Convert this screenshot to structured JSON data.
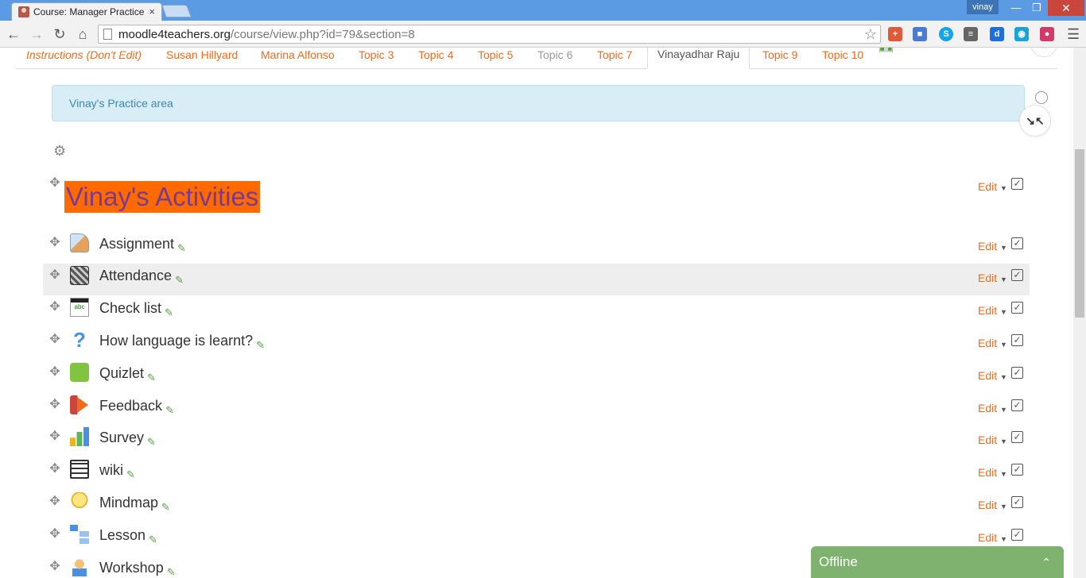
{
  "browser": {
    "tab_title": "Course: Manager Practice",
    "tab_close": "×",
    "user_name": "vinay",
    "url_host": "moodle4teachers.org",
    "url_path": "/course/view.php?id=79&section=8"
  },
  "course_tabs": [
    {
      "label": "Instructions (Don't Edit)",
      "style": "italic"
    },
    {
      "label": "Susan Hillyard"
    },
    {
      "label": "Marina Alfonso"
    },
    {
      "label": "Topic 3"
    },
    {
      "label": "Topic 4"
    },
    {
      "label": "Topic 5"
    },
    {
      "label": "Topic 6",
      "style": "muted"
    },
    {
      "label": "Topic 7"
    },
    {
      "label": "Vinayadhar Raju",
      "style": "current"
    },
    {
      "label": "Topic 9"
    },
    {
      "label": "Topic 10"
    }
  ],
  "section": {
    "summary": "Vinay's Practice area",
    "heading": "Vinay's Activities"
  },
  "edit_label": "Edit",
  "activities": [
    {
      "name": "Assignment",
      "icon": "assignment-icon"
    },
    {
      "name": "Attendance",
      "icon": "attendance-icon",
      "highlighted": true
    },
    {
      "name": "Check list",
      "icon": "checklist-icon"
    },
    {
      "name": "How language is learnt?",
      "icon": "question-icon"
    },
    {
      "name": "Quizlet",
      "icon": "quizlet-icon"
    },
    {
      "name": "Feedback",
      "icon": "feedback-icon"
    },
    {
      "name": "Survey",
      "icon": "survey-icon"
    },
    {
      "name": "wiki",
      "icon": "wiki-icon"
    },
    {
      "name": "Mindmap",
      "icon": "mindmap-icon"
    },
    {
      "name": "Lesson",
      "icon": "lesson-icon"
    },
    {
      "name": "Workshop",
      "icon": "workshop-icon"
    }
  ],
  "chat": {
    "status": "Offline"
  },
  "colors": {
    "link": "#f06a1a",
    "heading_bg": "#ff6a00",
    "heading_text": "#7a3a91",
    "info_bg": "#d9edf7",
    "offline_bar": "#7fb26f"
  }
}
